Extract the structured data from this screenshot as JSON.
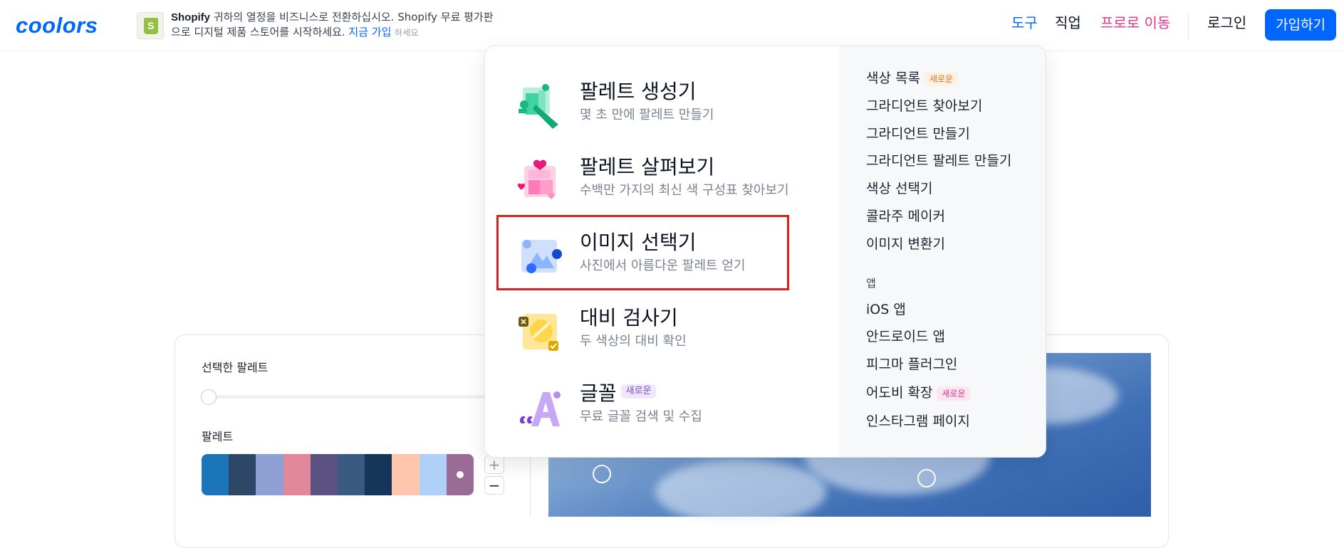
{
  "header": {
    "logo": "coolors",
    "ad": {
      "brand": "Shopify",
      "text1": " 귀하의 열정을 비즈니스로 전환하십시오. Shopify 무료 평가판",
      "text2": "으로 디지털 제품 스토어를 시작하세요. ",
      "cta": "지금 가입",
      "small": "하세요"
    },
    "nav": {
      "tools": "도구",
      "jobs": "직업",
      "pro": "프로로 이동",
      "login": "로그인",
      "signup": "가입하기"
    }
  },
  "dropdown": {
    "tools": [
      {
        "title": "팔레트 생성기",
        "subtitle": "몇 초 만에 팔레트 만들기",
        "icon": "palette-generator-icon"
      },
      {
        "title": "팔레트 살펴보기",
        "subtitle": "수백만 가지의 최신 색 구성표 찾아보기",
        "icon": "explore-palettes-icon"
      },
      {
        "title": "이미지 선택기",
        "subtitle": "사진에서 아름다운 팔레트 얻기",
        "icon": "image-picker-icon"
      },
      {
        "title": "대비 검사기",
        "subtitle": "두 색상의 대비 확인",
        "icon": "contrast-checker-icon"
      },
      {
        "title": "글꼴",
        "subtitle": "무료 글꼴 검색 및 수집",
        "icon": "fonts-icon",
        "badge": "새로운"
      }
    ],
    "links": [
      {
        "label": "색상 목록",
        "badge": "새로운"
      },
      {
        "label": "그라디언트 찾아보기"
      },
      {
        "label": "그라디언트 만들기"
      },
      {
        "label": "그라디언트 팔레트 만들기"
      },
      {
        "label": "색상 선택기"
      },
      {
        "label": "콜라주 메이커"
      },
      {
        "label": "이미지 변환기"
      }
    ],
    "apps_heading": "앱",
    "apps": [
      {
        "label": "iOS 앱"
      },
      {
        "label": "안드로이드 앱"
      },
      {
        "label": "피그마 플러그인"
      },
      {
        "label": "어도비 확장",
        "badge": "새로운"
      },
      {
        "label": "인스타그램 페이지"
      }
    ]
  },
  "page": {
    "selected_palette_label": "선택한 팔레트",
    "palette_label": "팔레트",
    "palette_colors": [
      "#1b75b8",
      "#2c4866",
      "#8e9fd3",
      "#e0879c",
      "#5b5182",
      "#3a5a82",
      "#163659",
      "#ffc6ad",
      "#afd1f7",
      "#9b6b98"
    ],
    "stepper_plus": "+",
    "stepper_minus": "−"
  }
}
